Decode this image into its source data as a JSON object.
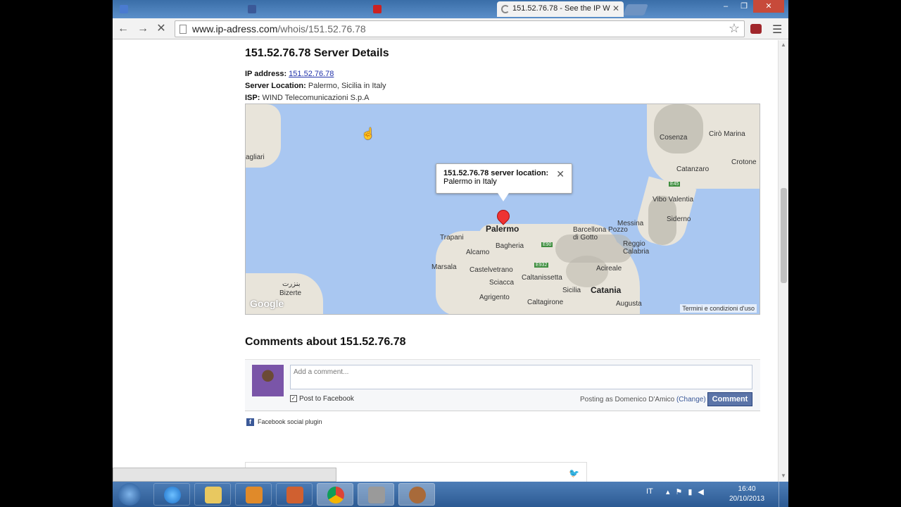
{
  "browser": {
    "tabs": [
      {
        "label": "",
        "color": "#4a7bd0"
      },
      {
        "label": "",
        "color": "#3b5998"
      },
      {
        "label": "",
        "color": "#cc2222"
      },
      {
        "label": "151.52.76.78 - See the IP W",
        "color": "#888888",
        "active": true
      }
    ],
    "url_host": "www.ip-adress.com",
    "url_path": "/whois/151.52.76.78",
    "window_controls": {
      "minimize": "–",
      "maximize": "❐",
      "close": "✕"
    }
  },
  "page": {
    "title": "151.52.76.78 Server Details",
    "ip_label": "IP address:",
    "ip_value": "151.52.76.78",
    "location_label": "Server Location:",
    "location_value": "Palermo, Sicilia in Italy",
    "isp_label": "ISP:",
    "isp_value": "WIND Telecomunicazioni S.p.A"
  },
  "map": {
    "bubble_title": "151.52.76.78 server location:",
    "bubble_text": "Palermo in Italy",
    "cities": {
      "palermo": "Palermo",
      "trapani": "Trapani",
      "alcamo": "Alcamo",
      "marsala": "Marsala",
      "castelvetrano": "Castelvetrano",
      "bagheria": "Bagheria",
      "sciacca": "Sciacca",
      "agrigento": "Agrigento",
      "caltanissetta": "Caltanissetta",
      "caltagirone": "Caltagirone",
      "catania": "Catania",
      "augusta": "Augusta",
      "acireale": "Acireale",
      "messina": "Messina",
      "reggio": "Reggio Calabria",
      "barcellona": "Barcellona Pozzo di Gotto",
      "vibo": "Vibo Valentia",
      "cosenza": "Cosenza",
      "catanzaro": "Catanzaro",
      "cirò": "Cirò Marina",
      "crotone": "Crotone",
      "siderno": "Siderno",
      "bizerte": "Bizerte",
      "bizerte_ar": "بنزرت",
      "sicilia": "Sicilia",
      "cagliari": "agliari"
    },
    "road_labels": [
      "E45",
      "E90",
      "E932",
      "E45"
    ],
    "google": "Google",
    "terms": "Termini e condizioni d'uso"
  },
  "comments": {
    "title": "Comments about 151.52.76.78",
    "placeholder": "Add a comment...",
    "post_to_facebook": "Post to Facebook",
    "posting_as": "Posting as Domenico D'Amico",
    "change": "(Change)",
    "comment_button": "Comment",
    "plugin_label": "Facebook social plugin"
  },
  "taskbar": {
    "lang": "IT",
    "time": "16:40",
    "date": "20/10/2013"
  },
  "colors": {
    "map_water": "#a9c7f1",
    "pin": "#ee3333",
    "facebook_blue": "#3b5998"
  }
}
